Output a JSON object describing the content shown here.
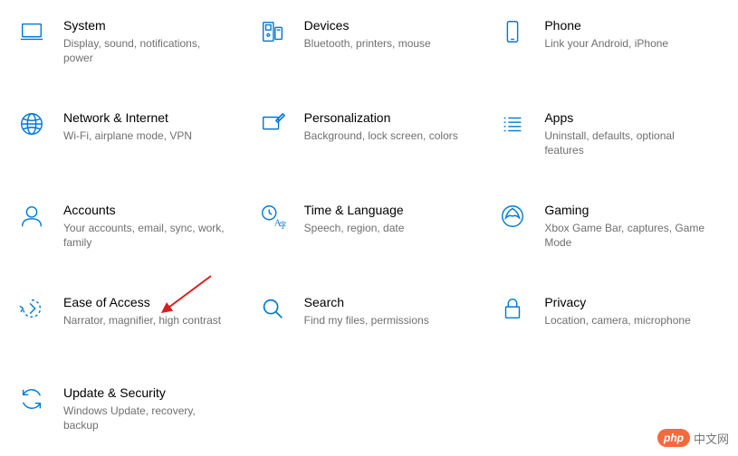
{
  "settings": [
    {
      "id": "system",
      "title": "System",
      "desc": "Display, sound, notifications, power"
    },
    {
      "id": "devices",
      "title": "Devices",
      "desc": "Bluetooth, printers, mouse"
    },
    {
      "id": "phone",
      "title": "Phone",
      "desc": "Link your Android, iPhone"
    },
    {
      "id": "network",
      "title": "Network & Internet",
      "desc": "Wi-Fi, airplane mode, VPN"
    },
    {
      "id": "personalization",
      "title": "Personalization",
      "desc": "Background, lock screen, colors"
    },
    {
      "id": "apps",
      "title": "Apps",
      "desc": "Uninstall, defaults, optional features"
    },
    {
      "id": "accounts",
      "title": "Accounts",
      "desc": "Your accounts, email, sync, work, family"
    },
    {
      "id": "time",
      "title": "Time & Language",
      "desc": "Speech, region, date"
    },
    {
      "id": "gaming",
      "title": "Gaming",
      "desc": "Xbox Game Bar, captures, Game Mode"
    },
    {
      "id": "ease",
      "title": "Ease of Access",
      "desc": "Narrator, magnifier, high contrast"
    },
    {
      "id": "search",
      "title": "Search",
      "desc": "Find my files, permissions"
    },
    {
      "id": "privacy",
      "title": "Privacy",
      "desc": "Location, camera, microphone"
    },
    {
      "id": "update",
      "title": "Update & Security",
      "desc": "Windows Update, recovery, backup"
    }
  ],
  "watermark": {
    "badge": "php",
    "text": "中文网"
  },
  "accent_color": "#0078d4",
  "arrow_color": "#d81e1e"
}
